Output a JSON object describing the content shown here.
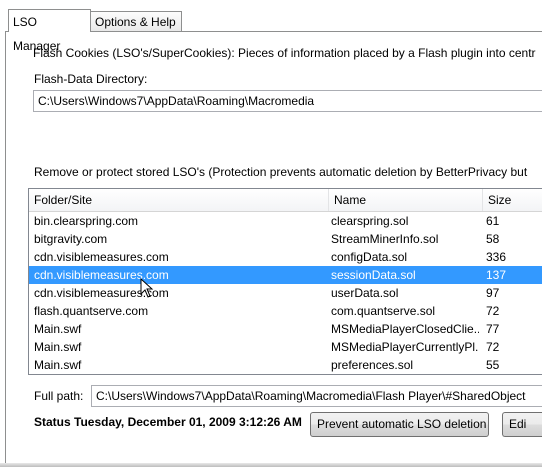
{
  "tabs": [
    {
      "label": "LSO Manager"
    },
    {
      "label": "Options & Help"
    }
  ],
  "description": "Flash Cookies (LSO's/SuperCookies): Pieces of information placed by a Flash plugin into centr",
  "directory": {
    "label": "Flash-Data Directory:",
    "value": "C:\\Users\\Windows7\\AppData\\Roaming\\Macromedia"
  },
  "remove_text": "Remove or protect stored LSO's (Protection prevents automatic deletion by BetterPrivacy but",
  "table": {
    "columns": [
      "Folder/Site",
      "Name",
      "Size"
    ],
    "rows": [
      {
        "folder": "bin.clearspring.com",
        "name": "clearspring.sol",
        "size": "61"
      },
      {
        "folder": "bitgravity.com",
        "name": "StreamMinerInfo.sol",
        "size": "58"
      },
      {
        "folder": "cdn.visiblemeasures.com",
        "name": "configData.sol",
        "size": "336"
      },
      {
        "folder": "cdn.visiblemeasures.com",
        "name": "sessionData.sol",
        "size": "137"
      },
      {
        "folder": "cdn.visiblemeasures.com",
        "name": "userData.sol",
        "size": "97"
      },
      {
        "folder": "flash.quantserve.com",
        "name": "com.quantserve.sol",
        "size": "72"
      },
      {
        "folder": "Main.swf",
        "name": "MSMediaPlayerClosedClie...",
        "size": "77"
      },
      {
        "folder": "Main.swf",
        "name": "MSMediaPlayerCurrentlyPl...",
        "size": "72"
      },
      {
        "folder": "Main.swf",
        "name": "preferences.sol",
        "size": "55"
      }
    ],
    "selected_row": 3
  },
  "full_path": {
    "label": "Full path:",
    "value": "C:\\Users\\Windows7\\AppData\\Roaming\\Macromedia\\Flash Player\\#SharedObject"
  },
  "status": "Status Tuesday, December 01, 2009 3:12:26 AM",
  "buttons": {
    "prevent": "Prevent automatic LSO deletion",
    "edit": "Edi"
  },
  "colors": {
    "selection": "#3399ff",
    "border": "#8e8f8f"
  }
}
